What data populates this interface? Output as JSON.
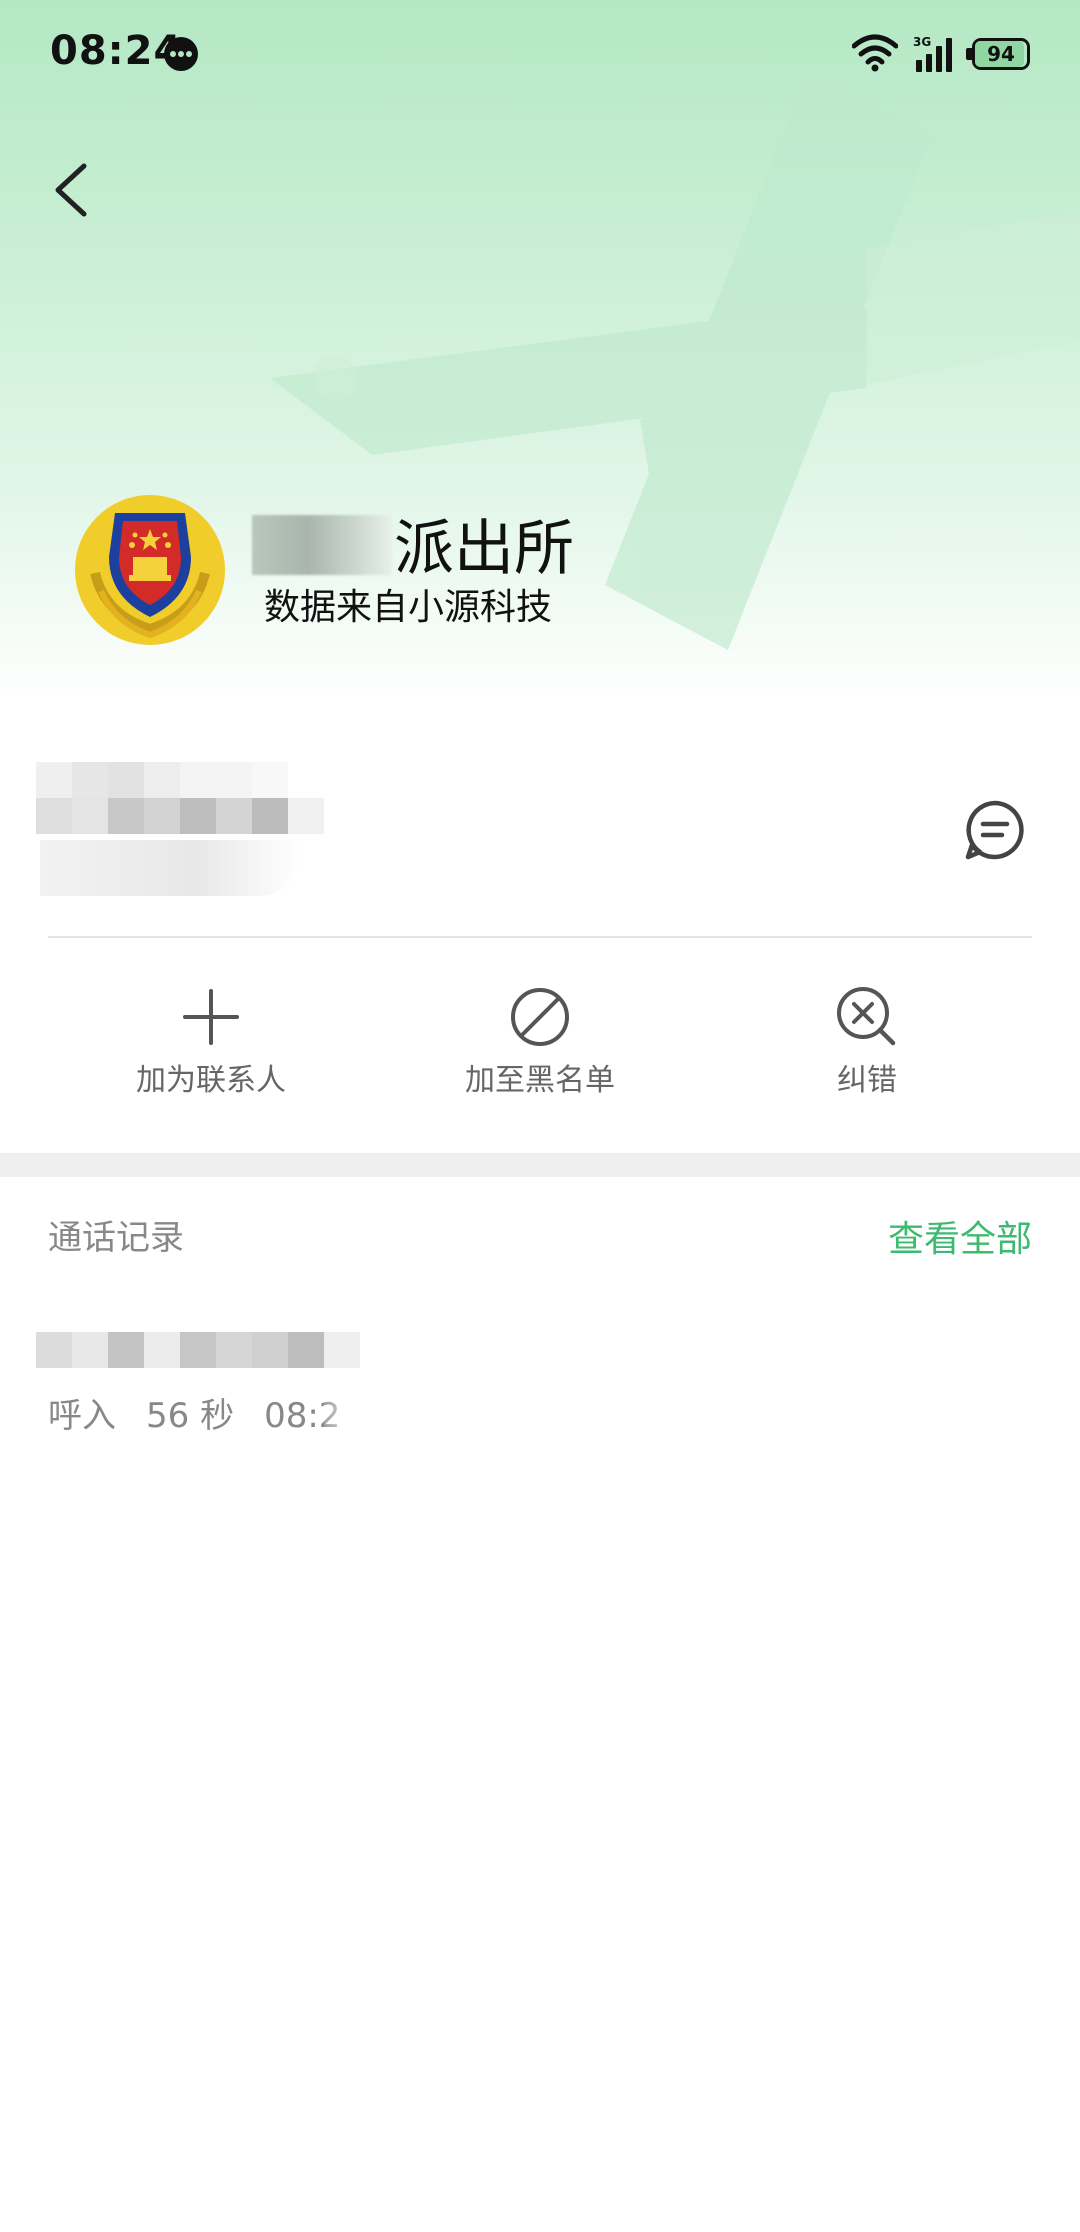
{
  "statusbar": {
    "time": "08:24",
    "battery": "94",
    "battery_level": 0.94,
    "network": "3G",
    "icons": [
      "message-bubble-icon",
      "wifi-icon",
      "signal-icon",
      "battery-icon"
    ]
  },
  "navigation": {
    "back_icon": "chevron-left-icon"
  },
  "org": {
    "name_suffix": "派出所",
    "source": "数据来自小源科技",
    "avatar_icon": "police-emblem-icon"
  },
  "number": {
    "sms_icon": "message-icon"
  },
  "actions": [
    {
      "label": "加为联系人",
      "icon": "plus-icon"
    },
    {
      "label": "加至黑名单",
      "icon": "block-icon"
    },
    {
      "label": "纠错",
      "icon": "search-error-icon"
    }
  ],
  "calls": {
    "title": "通话记录",
    "view_all": "查看全部",
    "items": [
      {
        "direction": "呼入",
        "duration": "56 秒",
        "time": "08:2"
      }
    ]
  },
  "colors": {
    "accent": "#3dba6f",
    "hero_top": "#b4e8c4",
    "divider": "#e4e4e4",
    "section_gap": "#efefef"
  }
}
